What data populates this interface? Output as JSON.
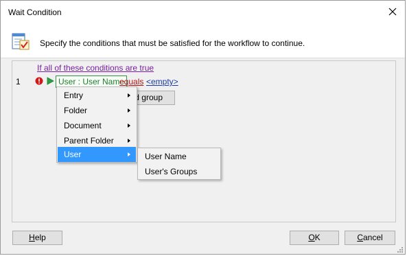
{
  "window": {
    "title": "Wait Condition",
    "close_icon": "close-icon"
  },
  "header": {
    "icon": "checklist-icon",
    "instruction": "Specify the conditions that must be satisfied for the workflow to continue."
  },
  "conditions": {
    "group_header": "If all of these conditions are true",
    "rows": [
      {
        "number": "1",
        "status_icon": "error-icon",
        "run_icon": "play-icon",
        "field": "User : User Name",
        "operator": "equals",
        "value": "<empty>"
      }
    ],
    "add_group_label": "d group"
  },
  "context_menu": {
    "items": [
      {
        "label": "Entry",
        "has_submenu": true
      },
      {
        "label": "Folder",
        "has_submenu": true
      },
      {
        "label": "Document",
        "has_submenu": true
      },
      {
        "label": "Parent Folder",
        "has_submenu": true
      },
      {
        "label": "User",
        "has_submenu": true,
        "selected": true
      }
    ],
    "submenu": {
      "items": [
        {
          "label": "User Name"
        },
        {
          "label": "User's Groups"
        }
      ]
    }
  },
  "buttons": {
    "help": {
      "label_underlined": "H",
      "label_rest": "elp"
    },
    "ok": {
      "label_underlined": "O",
      "label_rest": "K"
    },
    "cancel": {
      "label_underlined": "C",
      "label_rest": "ancel"
    }
  },
  "colors": {
    "menu_selection": "#3298fe",
    "field_text": "#1e7a2e",
    "operator_text": "#b01010",
    "value_text": "#1a3aa8",
    "group_header_text": "#7a1fa2",
    "error_red": "#d01818",
    "play_green": "#2ea043"
  }
}
